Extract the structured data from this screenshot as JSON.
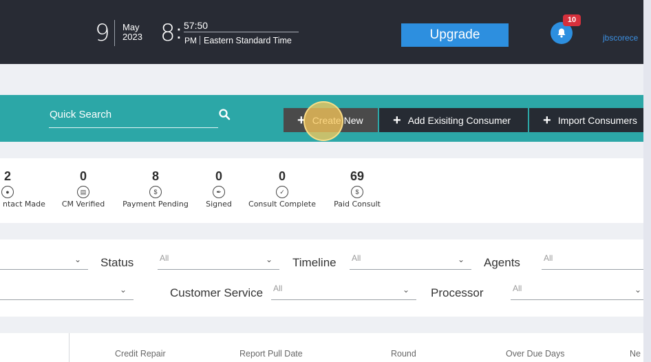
{
  "header": {
    "day": "9",
    "month": "May",
    "year": "2023",
    "hour": "8",
    "minsec": "57:50",
    "ampm": "PM",
    "timezone": "Eastern Standard Time",
    "upgrade_label": "Upgrade",
    "notification_count": "10",
    "username": "jbscorece"
  },
  "toolbar": {
    "search_label": "Quick Search",
    "create_label": "Create New",
    "add_label": "Add Exisiting Consumer",
    "import_label": "Import Consumers"
  },
  "stats": [
    {
      "count": "2",
      "label": "ntact Made",
      "icon": "chat-icon"
    },
    {
      "count": "0",
      "label": "CM Verified",
      "icon": "card-icon"
    },
    {
      "count": "8",
      "label": "Payment Pending",
      "icon": "dollar-icon"
    },
    {
      "count": "0",
      "label": "Signed",
      "icon": "signature-icon"
    },
    {
      "count": "0",
      "label": "Consult Complete",
      "icon": "check-icon"
    },
    {
      "count": "69",
      "label": "Paid Consult",
      "icon": "paid-icon"
    }
  ],
  "filters": {
    "status_label": "Status",
    "status_value": "All",
    "timeline_label": "Timeline",
    "timeline_value": "All",
    "agents_label": "Agents",
    "agents_value": "All",
    "customer_service_label": "Customer Service",
    "customer_service_value": "All",
    "processor_label": "Processor",
    "processor_value": "All"
  },
  "table": {
    "columns": [
      "Credit Repair",
      "Report Pull Date",
      "Round",
      "Over Due Days",
      "Ne"
    ]
  },
  "colors": {
    "header_bg": "#282b34",
    "teal": "#2ca7a7",
    "upgrade_blue": "#2d8fdf",
    "badge_red": "#d6303c"
  }
}
